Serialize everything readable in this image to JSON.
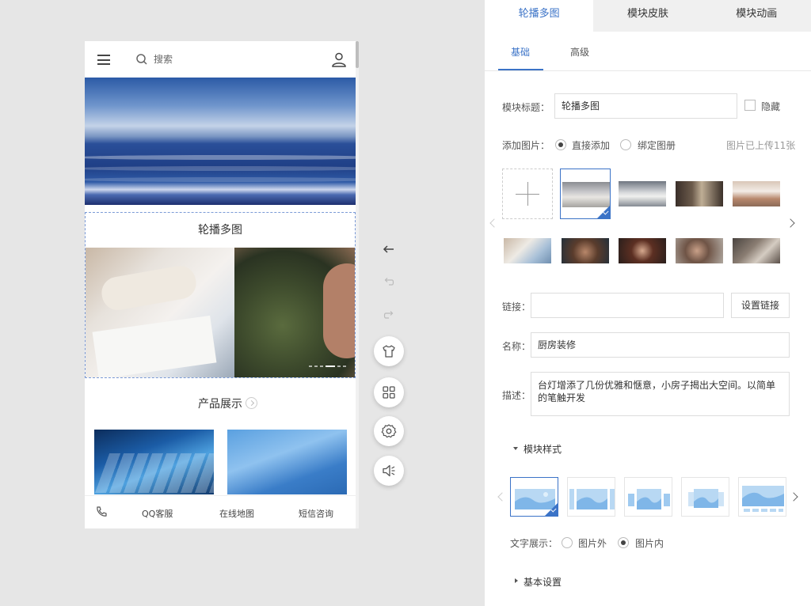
{
  "phone": {
    "search_placeholder": "搜索",
    "module_title": "轮播多图",
    "section_title": "产品展示",
    "footer": {
      "qq": "QQ客服",
      "map": "在线地图",
      "sms": "短信咨询"
    }
  },
  "panel": {
    "tabs": [
      "轮播多图",
      "模块皮肤",
      "模块动画"
    ],
    "subtabs": [
      "基础",
      "高级"
    ],
    "title_label": "模块标题：",
    "title_value": "轮播多图",
    "hide_label": "隐藏",
    "add_image_label": "添加图片：",
    "add_direct": "直接添加",
    "bind_album": "绑定图册",
    "uploaded": "图片已上传11张",
    "link_label": "链接：",
    "link_value": "",
    "set_link": "设置链接",
    "name_label": "名称：",
    "name_value": "厨房装修",
    "desc_label": "描述：",
    "desc_value": "台灯增添了几份优雅和惬意，小房子揭出大空间。以简单的笔触开发",
    "style_section": "模块样式",
    "text_display_label": "文字展示：",
    "text_outside": "图片外",
    "text_inside": "图片内",
    "basic_settings": "基本设置"
  },
  "colors": {
    "accent": "#3b73c7"
  }
}
